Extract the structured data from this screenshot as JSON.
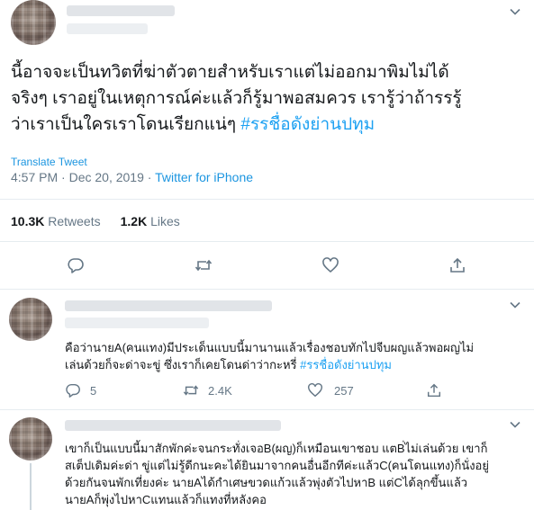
{
  "tweet": {
    "text": "นี้อาจจะเป็นทวิตที่ฆ่าตัวตายสำหรับเราแต่ไม่ออกมาพิมไม่ได้\nจริงๆ เราอยู่ในเหตุการณ์ค่ะแล้วก็รู้มาพอสมควร เรารู้ว่าถ้ารรรู้\nว่าเราเป็นใครเราโดนเรียกแน่ๆ ",
    "hashtag": "#รรชื่อดังย่านปทุม",
    "translate_label": "Translate Tweet",
    "time": "4:57 PM · Dec 20, 2019",
    "separator": " · ",
    "source": "Twitter for iPhone",
    "retweets_count": "10.3K",
    "retweets_label": "Retweets",
    "likes_count": "1.2K",
    "likes_label": "Likes"
  },
  "replies": [
    {
      "text": "คือว่านายA(คนแทง)มีประเด็นแบบนี้มานานแล้วเรื่องชอบทักไปจีบผญแล้วพอผญไม่\nเล่นด้วยก็จะด่าจะขู่ ซึ่งเราก็เคยโดนด่าว่ากะหรี่ ",
      "hashtag": "#รรชื่อดังย่านปทุม",
      "reply_count": "5",
      "retweet_count": "2.4K",
      "like_count": "257"
    },
    {
      "text": "เขาก็เป็นแบบนี้มาสักพักค่ะจนกระทั่งเจอB(ผญ)ก็เหมือนเขาชอบ แตB่ไม่เล่นด้วย เขาก็\nสเต็ปเดิมค่ะด่า ขู่แต่ไม่รู้ดีกนะคะได้ยินมาจากคนอื่นอีกทีค่ะแล้วC(คนโดนแทง)ก็นั่งอยู่\nด้วยกันจนพักเที่ยงค่ะ นายAได้กำเศษขวดแก้วแล้วพุ่งตัวไปหาB แต่Cได้ลุกขึ้นแล้ว\nนายAก็พุ่งไปหาCแทนแล้วก็แทงที่หลังคอ"
    }
  ],
  "colors": {
    "accent": "#1da1f2",
    "muted": "#657786",
    "text": "#14171a",
    "border": "#e6ecf0",
    "retweet": "#657786"
  },
  "icons": [
    "chevron-down-icon",
    "reply-icon",
    "retweet-icon",
    "like-icon",
    "share-icon"
  ]
}
